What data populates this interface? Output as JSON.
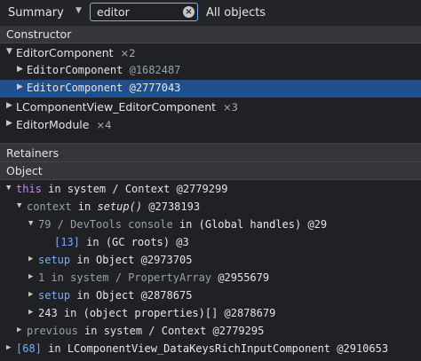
{
  "toolbar": {
    "view_select": "Summary",
    "search_value": "editor",
    "scope_select": "All objects"
  },
  "constructor_panel": {
    "header": "Constructor",
    "rows": [
      {
        "name": "EditorComponent",
        "count": "×2"
      },
      {
        "name": "EditorComponent",
        "id": "@1682487"
      },
      {
        "name": "EditorComponent",
        "id": "@2777043"
      },
      {
        "name": "LComponentView_EditorComponent",
        "count": "×3"
      },
      {
        "name": "EditorModule",
        "count": "×4"
      }
    ]
  },
  "retainers_header": "Retainers",
  "object_header": "Object",
  "retainers": [
    {
      "a": "this",
      "b": " in system / Context ",
      "c": "@2779299"
    },
    {
      "a": "context",
      "b": " in ",
      "b2": "setup()",
      "c": " @2738193"
    },
    {
      "a": "79 / DevTools console",
      "b": " in ",
      "b2": "(Global handles)",
      "c": " @29"
    },
    {
      "a": "[13]",
      "b": " in ",
      "b2": "(GC roots)",
      "c": " @3"
    },
    {
      "a": "setup",
      "b": " in ",
      "b2": "Object",
      "c": " @2973705"
    },
    {
      "a": "1",
      "b": " in system / PropertyArray ",
      "c": "@2955679"
    },
    {
      "a": "setup",
      "b": " in ",
      "b2": "Object",
      "c": " @2878675"
    },
    {
      "a": "243",
      "b": " in ",
      "b2": "(object properties)[]",
      "c": " @2878679"
    },
    {
      "a": "previous",
      "b": " in system / Context ",
      "c": "@2779295"
    },
    {
      "a": "[68]",
      "b": " in ",
      "b2": "LComponentView_DataKeysRichInputComponent",
      "c": " @2910653"
    }
  ],
  "colors": {
    "background": "#202124",
    "selected_row": "#1f4f8c",
    "keyword": "#c58af9",
    "link_blue": "#7cacf8"
  }
}
